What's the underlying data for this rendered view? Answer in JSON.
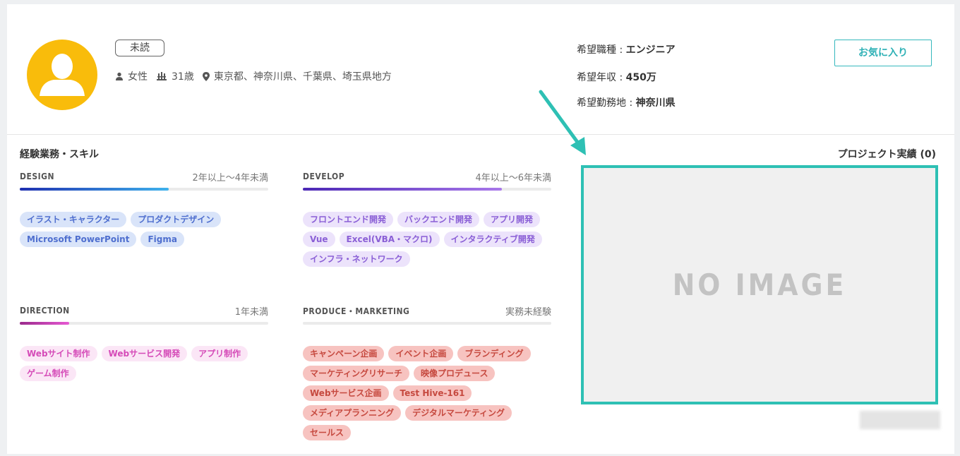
{
  "candidate": {
    "status_badge": "未読",
    "gender": "女性",
    "age": "31歳",
    "locations": "東京都、神奈川県、千葉県、埼玉県地方"
  },
  "desired": {
    "job_label": "希望職種 : ",
    "job_value": "エンジニア",
    "salary_label": "希望年収 : ",
    "salary_value": "450万",
    "location_label": "希望勤務地 : ",
    "location_value": "神奈川県"
  },
  "favorite_button": "お気に入り",
  "skills_section_title": "経験業務・スキル",
  "project_title": "プロジェクト実績 (0)",
  "no_image_text": "NO IMAGE",
  "skills": [
    {
      "name": "DESIGN",
      "years": "2年以上〜4年未満",
      "level": 0.6,
      "color_from": "#1e2fb0",
      "color_to": "#3fb2ec",
      "tags": [
        "イラスト・キャラクター",
        "プロダクトデザイン",
        "Microsoft PowerPoint",
        "Figma"
      ]
    },
    {
      "name": "DEVELOP",
      "years": "4年以上〜6年未満",
      "level": 0.8,
      "color_from": "#4b27b5",
      "color_to": "#a978ea",
      "tags": [
        "フロントエンド開発",
        "バックエンド開発",
        "アプリ開発",
        "Vue",
        "Excel(VBA・マクロ)",
        "インタラクティブ開発",
        "インフラ・ネットワーク"
      ]
    },
    {
      "name": "DIRECTION",
      "years": "1年未満",
      "level": 0.2,
      "color_from": "#9a2a8b",
      "color_to": "#e659d3",
      "tags": [
        "Webサイト制作",
        "Webサービス開発",
        "アプリ制作",
        "ゲーム制作"
      ]
    },
    {
      "name": "PRODUCE・MARKETING",
      "years": "実務未経験",
      "level": 0,
      "color_from": "#c6493f",
      "color_to": "#f07a6e",
      "tags": [
        "キャンペーン企画",
        "イベント企画",
        "ブランディング",
        "マーケティングリサーチ",
        "映像プロデュース",
        "Webサービス企画",
        "Test Hive-161",
        "メディアプランニング",
        "デジタルマーケティング",
        "セールス"
      ]
    }
  ]
}
